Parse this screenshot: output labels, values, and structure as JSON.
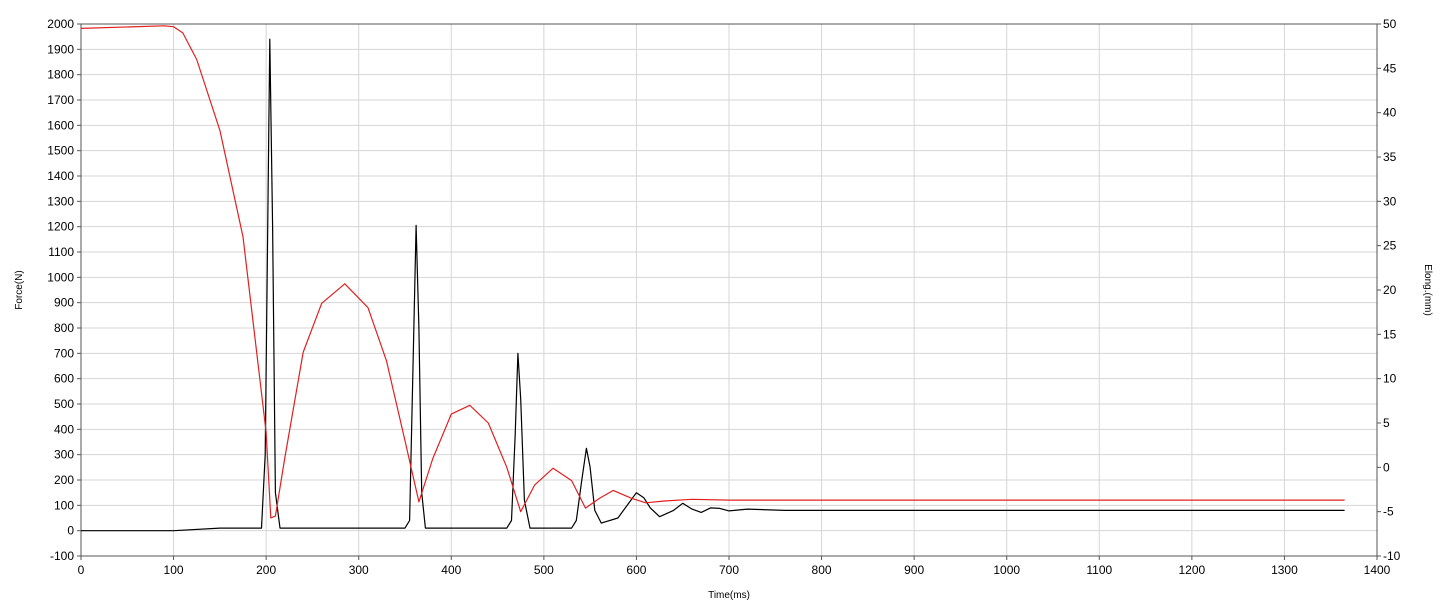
{
  "chart_data": {
    "type": "line",
    "title": "",
    "xlabel": "Time(ms)",
    "ylabel": "Force(N)",
    "y2label": "Elong.(mm)",
    "xlim": [
      0,
      1400
    ],
    "ylim": [
      -100,
      2000
    ],
    "y2lim": [
      -10,
      50
    ],
    "y2_inverted": true,
    "grid": true,
    "legend": "none",
    "x_ticks": [
      0,
      100,
      200,
      300,
      400,
      500,
      600,
      700,
      800,
      900,
      1000,
      1100,
      1200,
      1300,
      1400
    ],
    "y_ticks": [
      -100,
      0,
      100,
      200,
      300,
      400,
      500,
      600,
      700,
      800,
      900,
      1000,
      1100,
      1200,
      1300,
      1400,
      1500,
      1600,
      1700,
      1800,
      1900,
      2000
    ],
    "y2_ticks": [
      50,
      45,
      40,
      35,
      30,
      25,
      20,
      15,
      10,
      5,
      0,
      -5,
      -10
    ],
    "series": [
      {
        "axis": "left",
        "color": "#000000",
        "x": [
          0,
          100,
          150,
          195,
          199,
          202,
          204,
          207,
          210,
          215,
          350,
          355,
          359,
          362,
          365,
          368,
          372,
          460,
          465,
          469,
          472,
          475,
          479,
          485,
          530,
          535,
          541,
          546,
          550,
          555,
          562,
          580,
          600,
          608,
          615,
          625,
          640,
          650,
          660,
          670,
          680,
          690,
          700,
          720,
          760,
          900,
          1100,
          1300,
          1365
        ],
        "y": [
          0,
          0,
          10,
          10,
          300,
          1300,
          1940,
          1200,
          150,
          10,
          10,
          40,
          700,
          1205,
          800,
          150,
          10,
          10,
          40,
          380,
          700,
          520,
          120,
          10,
          10,
          40,
          200,
          325,
          250,
          80,
          30,
          50,
          150,
          130,
          90,
          55,
          80,
          108,
          85,
          72,
          90,
          88,
          78,
          85,
          80,
          80,
          80,
          80,
          80
        ]
      },
      {
        "axis": "right",
        "color": "#e02020",
        "x": [
          0,
          90,
          100,
          110,
          125,
          150,
          175,
          200,
          205,
          210,
          220,
          240,
          260,
          285,
          310,
          330,
          350,
          365,
          380,
          400,
          420,
          440,
          460,
          475,
          490,
          510,
          530,
          545,
          560,
          575,
          595,
          610,
          630,
          660,
          700,
          800,
          1000,
          1200,
          1365
        ],
        "y": [
          49.5,
          49.8,
          49.7,
          49,
          46,
          38,
          26,
          4,
          -5.7,
          -5.5,
          1,
          13,
          18.5,
          20.7,
          18,
          12,
          3,
          -3.9,
          1,
          6,
          7,
          5,
          0,
          -5,
          -2,
          -0.1,
          -1.5,
          -4.6,
          -3.5,
          -2.6,
          -3.5,
          -4,
          -3.8,
          -3.6,
          -3.7,
          -3.7,
          -3.7,
          -3.7,
          -3.7
        ]
      }
    ]
  }
}
